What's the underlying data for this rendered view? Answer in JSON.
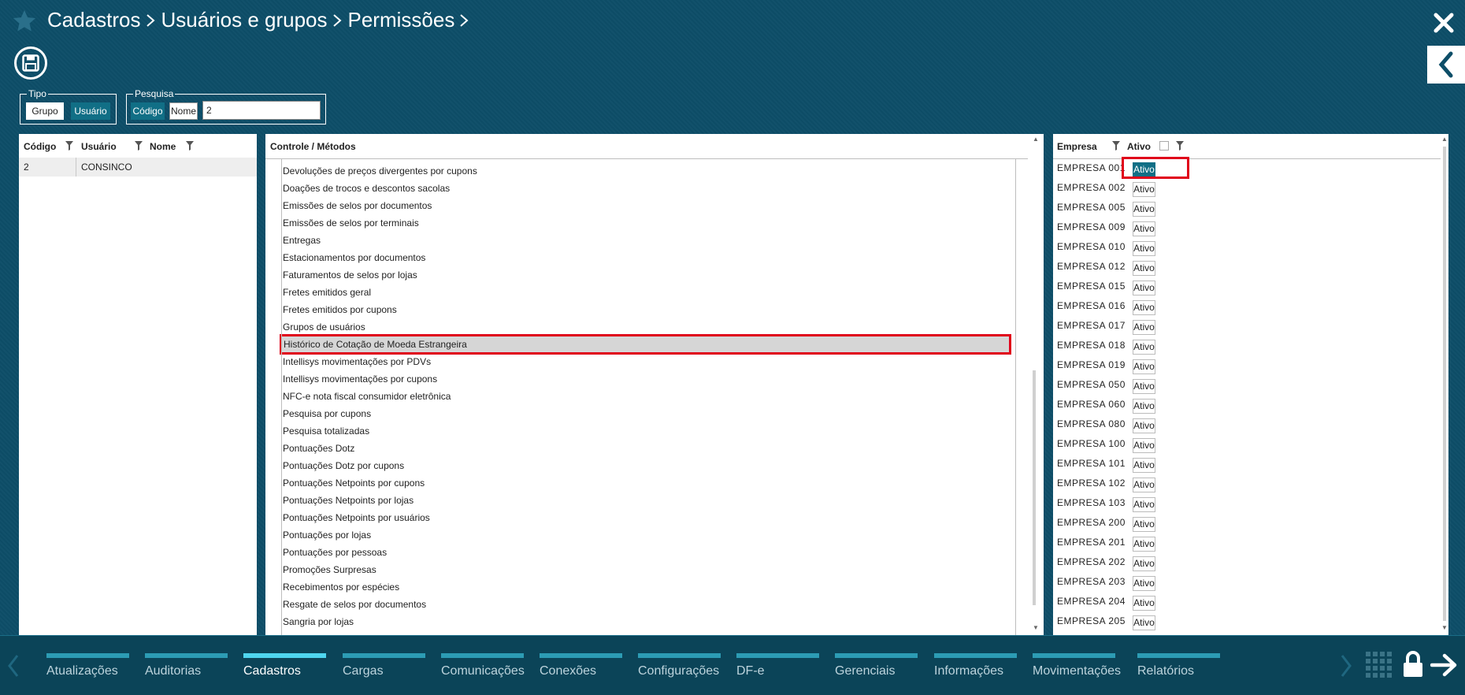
{
  "header": {
    "breadcrumb": [
      "Cadastros",
      "Usuários e grupos",
      "Permissões"
    ]
  },
  "tipo": {
    "legend": "Tipo",
    "options": [
      "Grupo",
      "Usuário"
    ],
    "selected": "Usuário"
  },
  "pesquisa": {
    "legend": "Pesquisa",
    "options": [
      "Código",
      "Nome"
    ],
    "selected": "Código",
    "value": "2"
  },
  "users_grid": {
    "columns": [
      "Código",
      "Usuário",
      "Nome"
    ],
    "rows": [
      {
        "codigo": "2",
        "usuario": "CONSINCO",
        "nome": ""
      }
    ]
  },
  "methods": {
    "header": "Controle / Métodos",
    "items": [
      "Devoluções de preços divergentes por cupons",
      "Doações de trocos e descontos sacolas",
      "Emissões de selos por documentos",
      "Emissões de selos por terminais",
      "Entregas",
      "Estacionamentos por documentos",
      "Faturamentos de selos por lojas",
      "Fretes emitidos geral",
      "Fretes emitidos por cupons",
      "Grupos de usuários",
      "Histórico de Cotação de Moeda Estrangeira",
      "Intellisys movimentações por PDVs",
      "Intellisys movimentações por cupons",
      "NFC-e nota fiscal consumidor eletrônica",
      "Pesquisa por cupons",
      "Pesquisa totalizadas",
      "Pontuações Dotz",
      "Pontuações Dotz por cupons",
      "Pontuações Netpoints por cupons",
      "Pontuações Netpoints por lojas",
      "Pontuações Netpoints por usuários",
      "Pontuações por lojas",
      "Pontuações por pessoas",
      "Promoções Surpresas",
      "Recebimentos por espécies",
      "Resgate de selos por documentos",
      "Sangria por lojas"
    ],
    "selected_index": 10
  },
  "companies": {
    "columns": [
      "Empresa",
      "Ativo"
    ],
    "button_label": "Ativo",
    "rows": [
      {
        "empresa": "EMPRESA 001",
        "active": true
      },
      {
        "empresa": "EMPRESA 002",
        "active": false
      },
      {
        "empresa": "EMPRESA 005",
        "active": false
      },
      {
        "empresa": "EMPRESA 009",
        "active": false
      },
      {
        "empresa": "EMPRESA 010",
        "active": false
      },
      {
        "empresa": "EMPRESA 012",
        "active": false
      },
      {
        "empresa": "EMPRESA 015",
        "active": false
      },
      {
        "empresa": "EMPRESA 016",
        "active": false
      },
      {
        "empresa": "EMPRESA 017",
        "active": false
      },
      {
        "empresa": "EMPRESA 018",
        "active": false
      },
      {
        "empresa": "EMPRESA 019",
        "active": false
      },
      {
        "empresa": "EMPRESA 050",
        "active": false
      },
      {
        "empresa": "EMPRESA 060",
        "active": false
      },
      {
        "empresa": "EMPRESA 080",
        "active": false
      },
      {
        "empresa": "EMPRESA 100",
        "active": false
      },
      {
        "empresa": "EMPRESA 101",
        "active": false
      },
      {
        "empresa": "EMPRESA 102",
        "active": false
      },
      {
        "empresa": "EMPRESA 103",
        "active": false
      },
      {
        "empresa": "EMPRESA 200",
        "active": false
      },
      {
        "empresa": "EMPRESA 201",
        "active": false
      },
      {
        "empresa": "EMPRESA 202",
        "active": false
      },
      {
        "empresa": "EMPRESA 203",
        "active": false
      },
      {
        "empresa": "EMPRESA 204",
        "active": false
      },
      {
        "empresa": "EMPRESA 205",
        "active": false
      }
    ]
  },
  "bottom_nav": {
    "tabs": [
      "Atualizações",
      "Auditorias",
      "Cadastros",
      "Cargas",
      "Comunicações",
      "Conexões",
      "Configurações",
      "DF-e",
      "Gerenciais",
      "Informações",
      "Movimentações",
      "Relatórios"
    ],
    "active": "Cadastros"
  },
  "colors": {
    "background": "#0d4e68",
    "accent": "#116f86",
    "highlight_border": "#e0001a",
    "selected_row": "#d6d6d6"
  }
}
